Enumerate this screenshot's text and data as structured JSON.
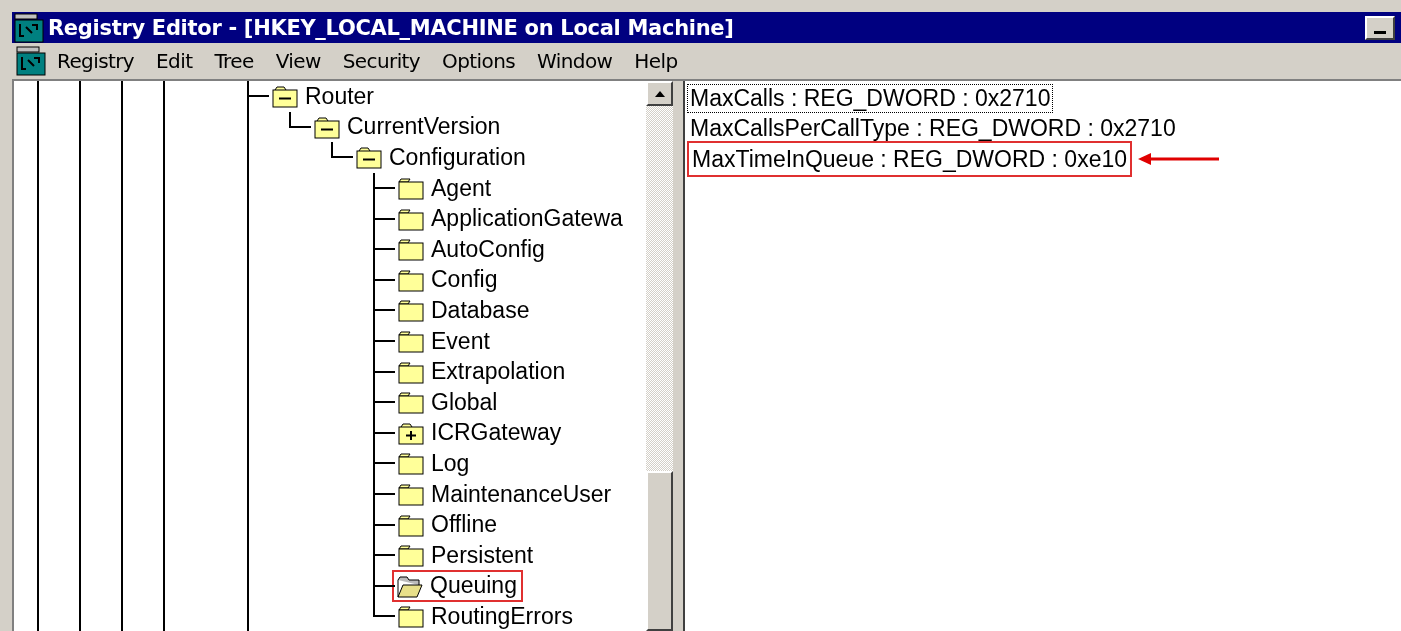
{
  "window": {
    "title": "Registry Editor - [HKEY_LOCAL_MACHINE on Local Machine]"
  },
  "menu": [
    "Registry",
    "Edit",
    "Tree",
    "View",
    "Security",
    "Options",
    "Window",
    "Help"
  ],
  "tree": [
    {
      "label": "Router",
      "kind": "expanded",
      "selected": false,
      "annotated": false,
      "children": [
        {
          "label": "CurrentVersion",
          "kind": "expanded",
          "selected": false,
          "annotated": false,
          "children": [
            {
              "label": "Configuration",
              "kind": "expanded",
              "selected": false,
              "annotated": false,
              "children": [
                {
                  "label": "Agent",
                  "kind": "leaf",
                  "selected": false,
                  "annotated": false
                },
                {
                  "label": "ApplicationGatewa",
                  "kind": "leaf",
                  "selected": false,
                  "annotated": false
                },
                {
                  "label": "AutoConfig",
                  "kind": "leaf",
                  "selected": false,
                  "annotated": false
                },
                {
                  "label": "Config",
                  "kind": "leaf",
                  "selected": false,
                  "annotated": false
                },
                {
                  "label": "Database",
                  "kind": "leaf",
                  "selected": false,
                  "annotated": false
                },
                {
                  "label": "Event",
                  "kind": "leaf",
                  "selected": false,
                  "annotated": false
                },
                {
                  "label": "Extrapolation",
                  "kind": "leaf",
                  "selected": false,
                  "annotated": false
                },
                {
                  "label": "Global",
                  "kind": "leaf",
                  "selected": false,
                  "annotated": false
                },
                {
                  "label": "ICRGateway",
                  "kind": "collapsed",
                  "selected": false,
                  "annotated": false
                },
                {
                  "label": "Log",
                  "kind": "leaf",
                  "selected": false,
                  "annotated": false
                },
                {
                  "label": "MaintenanceUser",
                  "kind": "leaf",
                  "selected": false,
                  "annotated": false
                },
                {
                  "label": "Offline",
                  "kind": "leaf",
                  "selected": false,
                  "annotated": false
                },
                {
                  "label": "Persistent",
                  "kind": "leaf",
                  "selected": false,
                  "annotated": false
                },
                {
                  "label": "Queuing",
                  "kind": "leaf",
                  "selected": true,
                  "annotated": true
                },
                {
                  "label": "RoutingErrors",
                  "kind": "leaf",
                  "selected": false,
                  "annotated": false
                }
              ]
            }
          ]
        }
      ]
    }
  ],
  "values": [
    {
      "text": "MaxCalls : REG_DWORD : 0x2710",
      "focused": true,
      "annotated": false
    },
    {
      "text": "MaxCallsPerCallType : REG_DWORD : 0x2710",
      "focused": false,
      "annotated": false
    },
    {
      "text": "MaxTimeInQueue : REG_DWORD : 0xe10",
      "focused": false,
      "annotated": true
    }
  ]
}
